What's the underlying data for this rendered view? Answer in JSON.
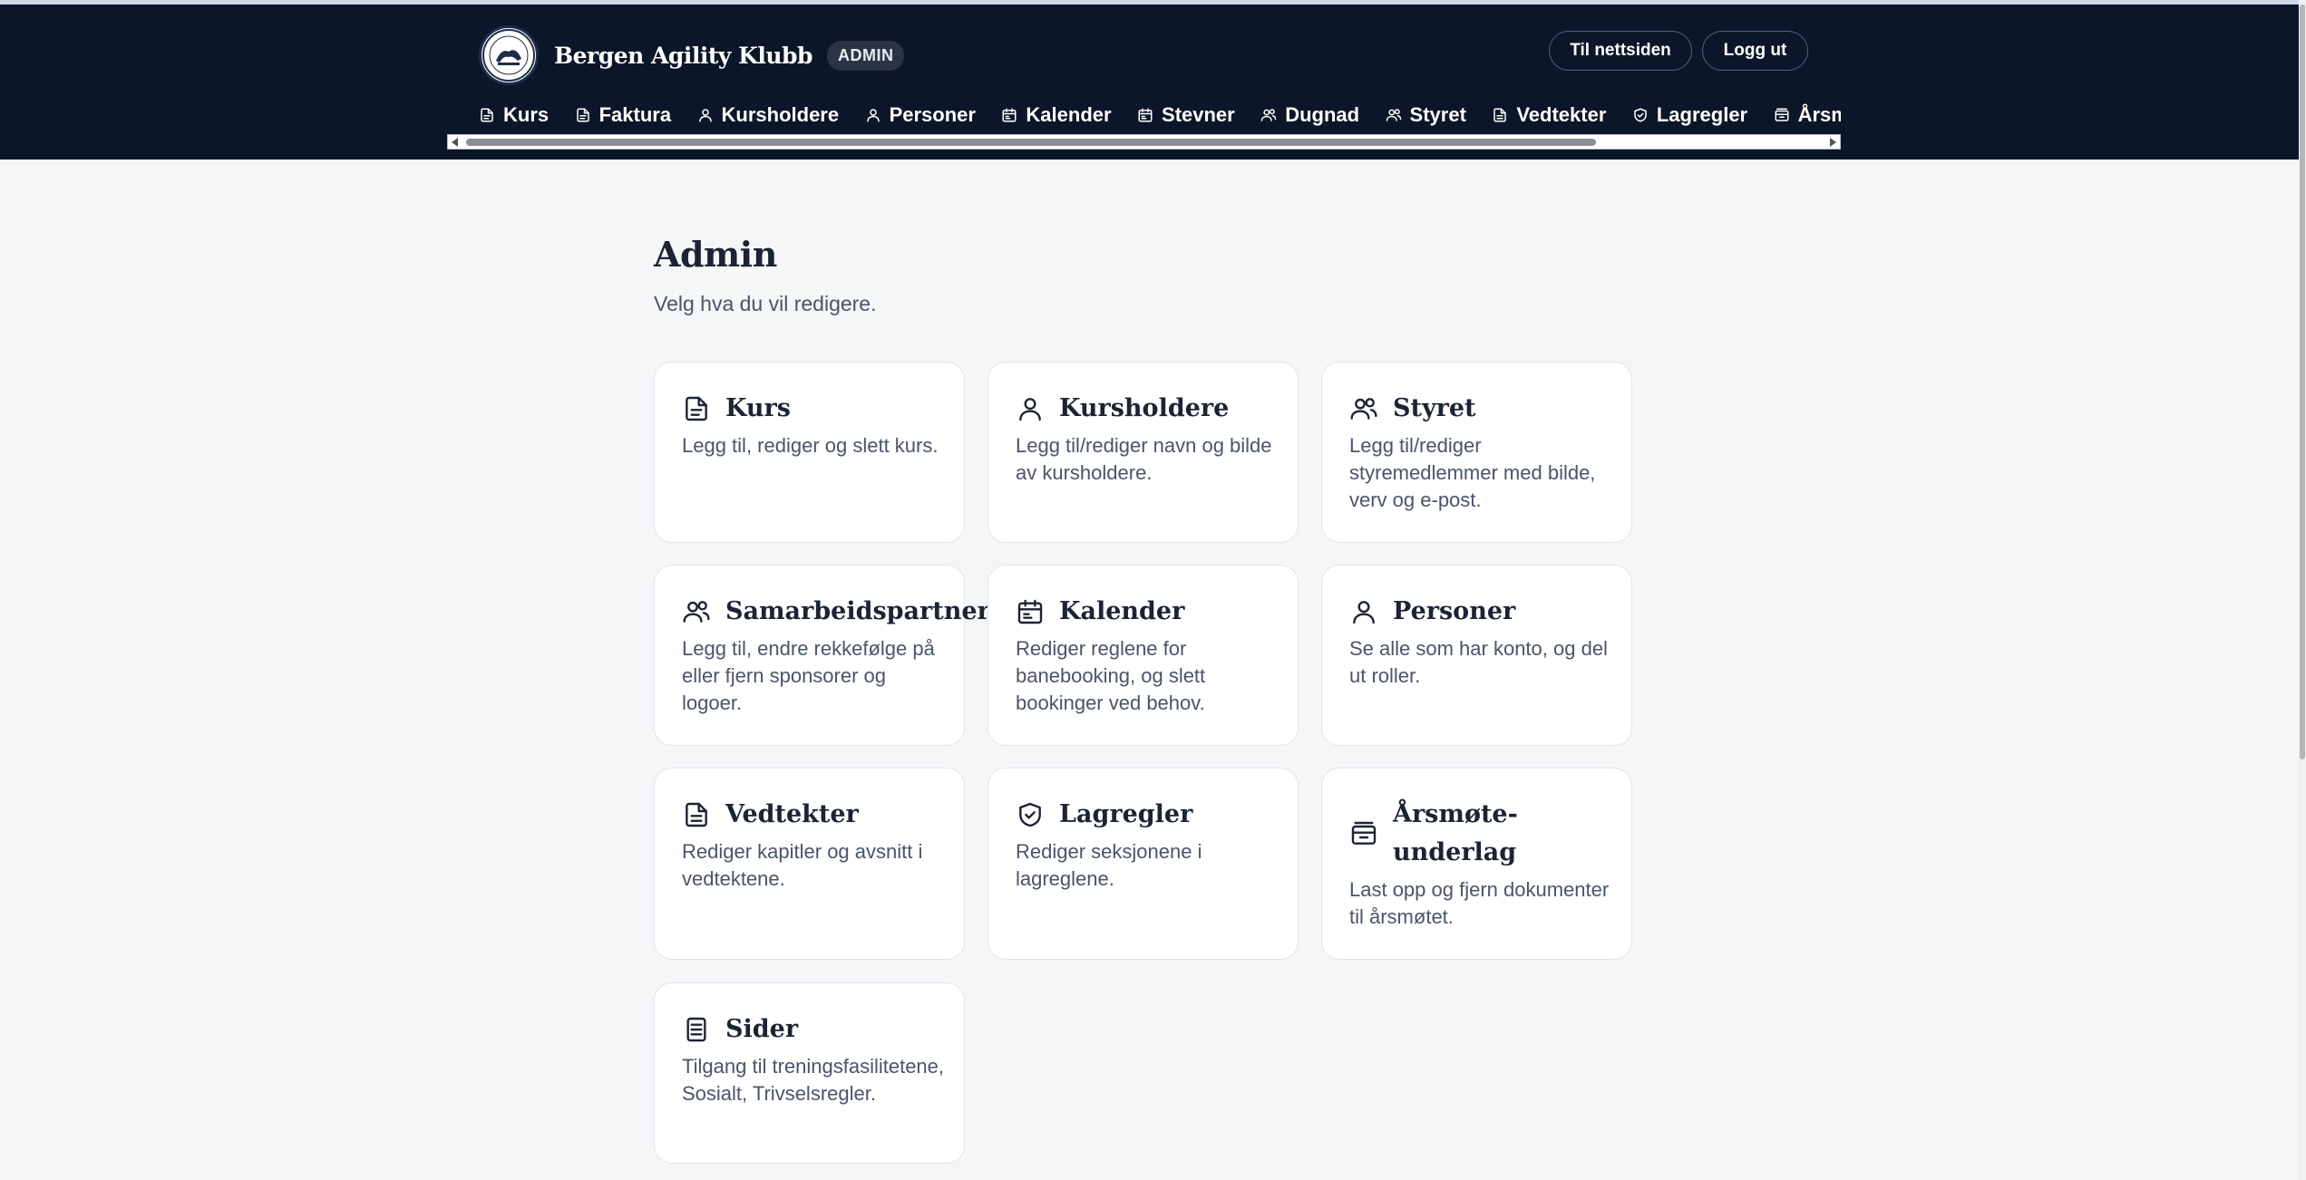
{
  "header": {
    "brand_name": "Bergen Agility Klubb",
    "badge": "ADMIN",
    "site_button": "Til nettsiden",
    "logout_button": "Logg ut",
    "nav_items": [
      {
        "label": "Kurs",
        "icon": "document-icon"
      },
      {
        "label": "Faktura",
        "icon": "document-icon"
      },
      {
        "label": "Kursholdere",
        "icon": "person-icon"
      },
      {
        "label": "Personer",
        "icon": "person-icon"
      },
      {
        "label": "Kalender",
        "icon": "calendar-icon"
      },
      {
        "label": "Stevner",
        "icon": "calendar-icon"
      },
      {
        "label": "Dugnad",
        "icon": "people-icon"
      },
      {
        "label": "Styret",
        "icon": "people-icon"
      },
      {
        "label": "Vedtekter",
        "icon": "file-icon"
      },
      {
        "label": "Lagregler",
        "icon": "shield-icon"
      },
      {
        "label": "Årsm",
        "icon": "archive-icon"
      }
    ]
  },
  "main": {
    "title": "Admin",
    "subtitle": "Velg hva du vil redigere.",
    "cards": [
      {
        "title": "Kurs",
        "desc": "Legg til, rediger og slett kurs.",
        "icon": "document-icon"
      },
      {
        "title": "Kursholdere",
        "desc": "Legg til/rediger navn og bilde av kursholdere.",
        "icon": "person-icon"
      },
      {
        "title": "Styret",
        "desc": "Legg til/rediger styremedlemmer med bilde, verv og e-post.",
        "icon": "people-icon"
      },
      {
        "title": "Samarbeidspartnere",
        "desc": "Legg til, endre rekkefølge på eller fjern sponsorer og logoer.",
        "icon": "people-icon"
      },
      {
        "title": "Kalender",
        "desc": "Rediger reglene for banebooking, og slett bookinger ved behov.",
        "icon": "calendar-icon"
      },
      {
        "title": "Personer",
        "desc": "Se alle som har konto, og del ut roller.",
        "icon": "person-icon"
      },
      {
        "title": "Vedtekter",
        "desc": "Rediger kapitler og avsnitt i vedtektene.",
        "icon": "file-icon"
      },
      {
        "title": "Lagregler",
        "desc": "Rediger seksjonene i lagreglene.",
        "icon": "shield-icon"
      },
      {
        "title": "Årsmøte-underlag",
        "desc": "Last opp og fjern dokumenter til årsmøtet.",
        "icon": "archive-icon"
      },
      {
        "title": "Sider",
        "desc": "Tilgang til treningsfasilitetene, Sosialt, Trivselsregler.",
        "icon": "page-icon"
      }
    ]
  }
}
